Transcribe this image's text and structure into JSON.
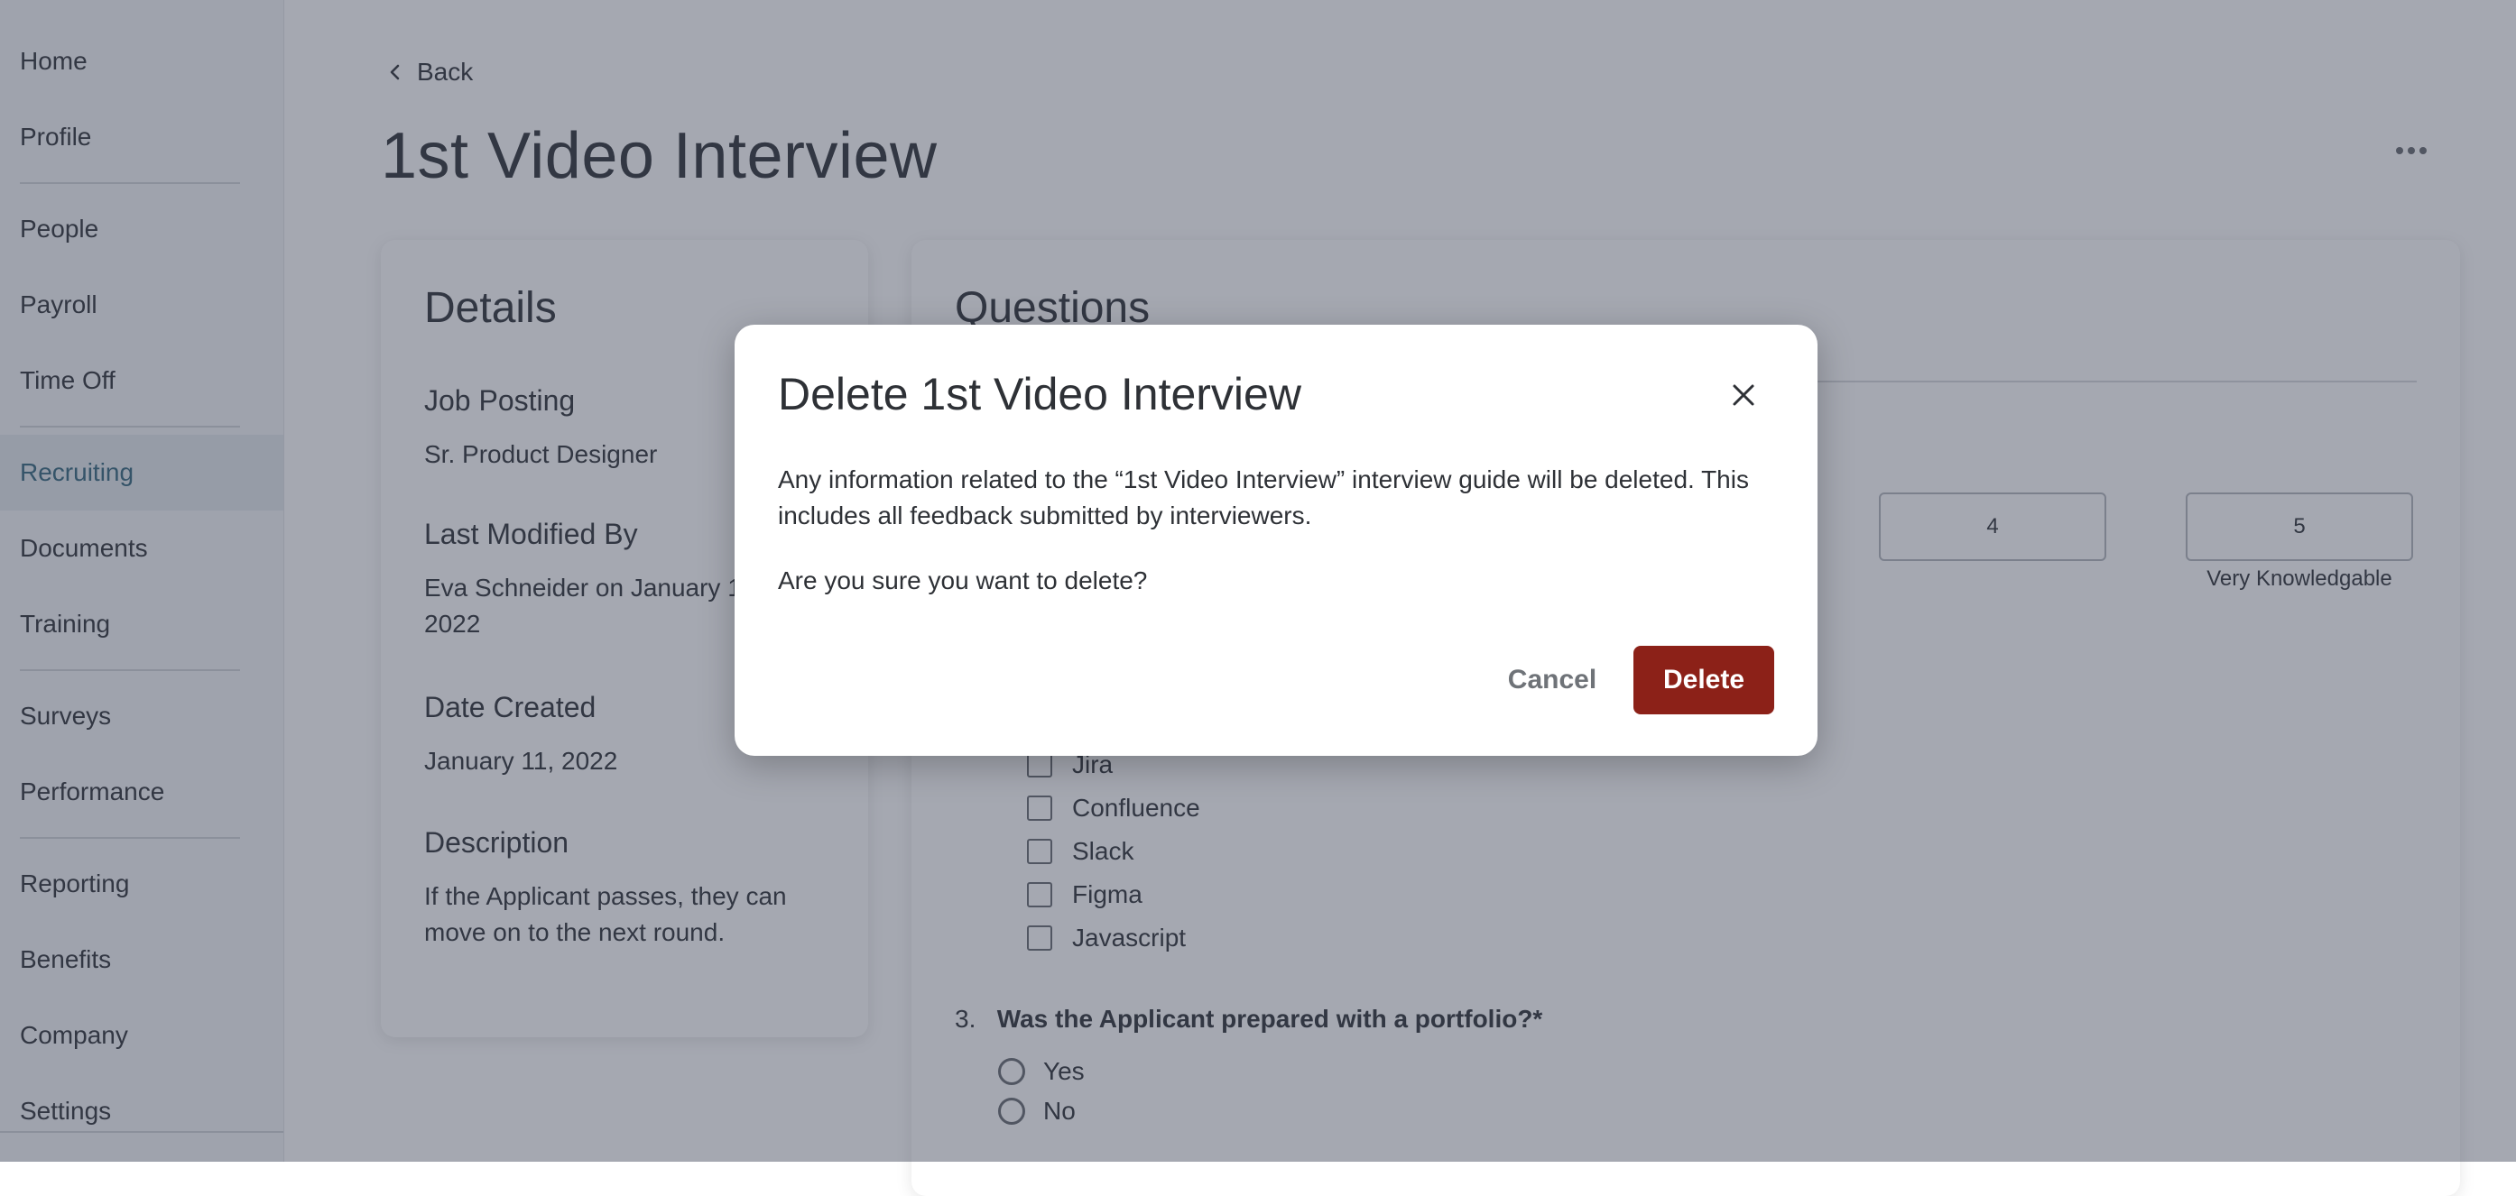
{
  "sidebar": {
    "items": [
      {
        "label": "Home"
      },
      {
        "label": "Profile"
      },
      {
        "label": "People"
      },
      {
        "label": "Payroll"
      },
      {
        "label": "Time Off"
      },
      {
        "label": "Recruiting",
        "active": true
      },
      {
        "label": "Documents"
      },
      {
        "label": "Training"
      },
      {
        "label": "Surveys"
      },
      {
        "label": "Performance"
      },
      {
        "label": "Reporting"
      },
      {
        "label": "Benefits"
      },
      {
        "label": "Company"
      },
      {
        "label": "Settings"
      }
    ]
  },
  "header": {
    "back_label": "Back",
    "back_icon": "chevron-left-icon",
    "title": "1st Video Interview",
    "more_icon": "more-horizontal-icon"
  },
  "details": {
    "heading": "Details",
    "job_posting_label": "Job Posting",
    "job_posting_value": "Sr. Product Designer",
    "last_modified_label": "Last Modified By",
    "last_modified_value": "Eva Schneider on January 13, 2022",
    "date_created_label": "Date Created",
    "date_created_value": "January 11, 2022",
    "description_label": "Description",
    "description_value": "If the Applicant passes, they can move on to the next round."
  },
  "questions": {
    "heading": "Questions",
    "scale": {
      "options": [
        "4",
        "5"
      ],
      "max_caption": "Very Knowledgable"
    },
    "checkbox_options": [
      "Jira",
      "Confluence",
      "Slack",
      "Figma",
      "Javascript"
    ],
    "q3": {
      "number": "3.",
      "text": "Was the Applicant prepared with a portfolio?*",
      "options": [
        "Yes",
        "No"
      ]
    }
  },
  "modal": {
    "title": "Delete 1st Video Interview",
    "close_icon": "close-icon",
    "body": "Any information related to the “1st Video Interview” interview guide will be deleted. This includes all feedback submitted by interviewers.",
    "question": "Are you sure you want to delete?",
    "cancel_label": "Cancel",
    "delete_label": "Delete"
  },
  "colors": {
    "accent": "#3f6e84",
    "danger": "#8c2118",
    "overlay": "rgba(40,48,68,0.42)"
  }
}
